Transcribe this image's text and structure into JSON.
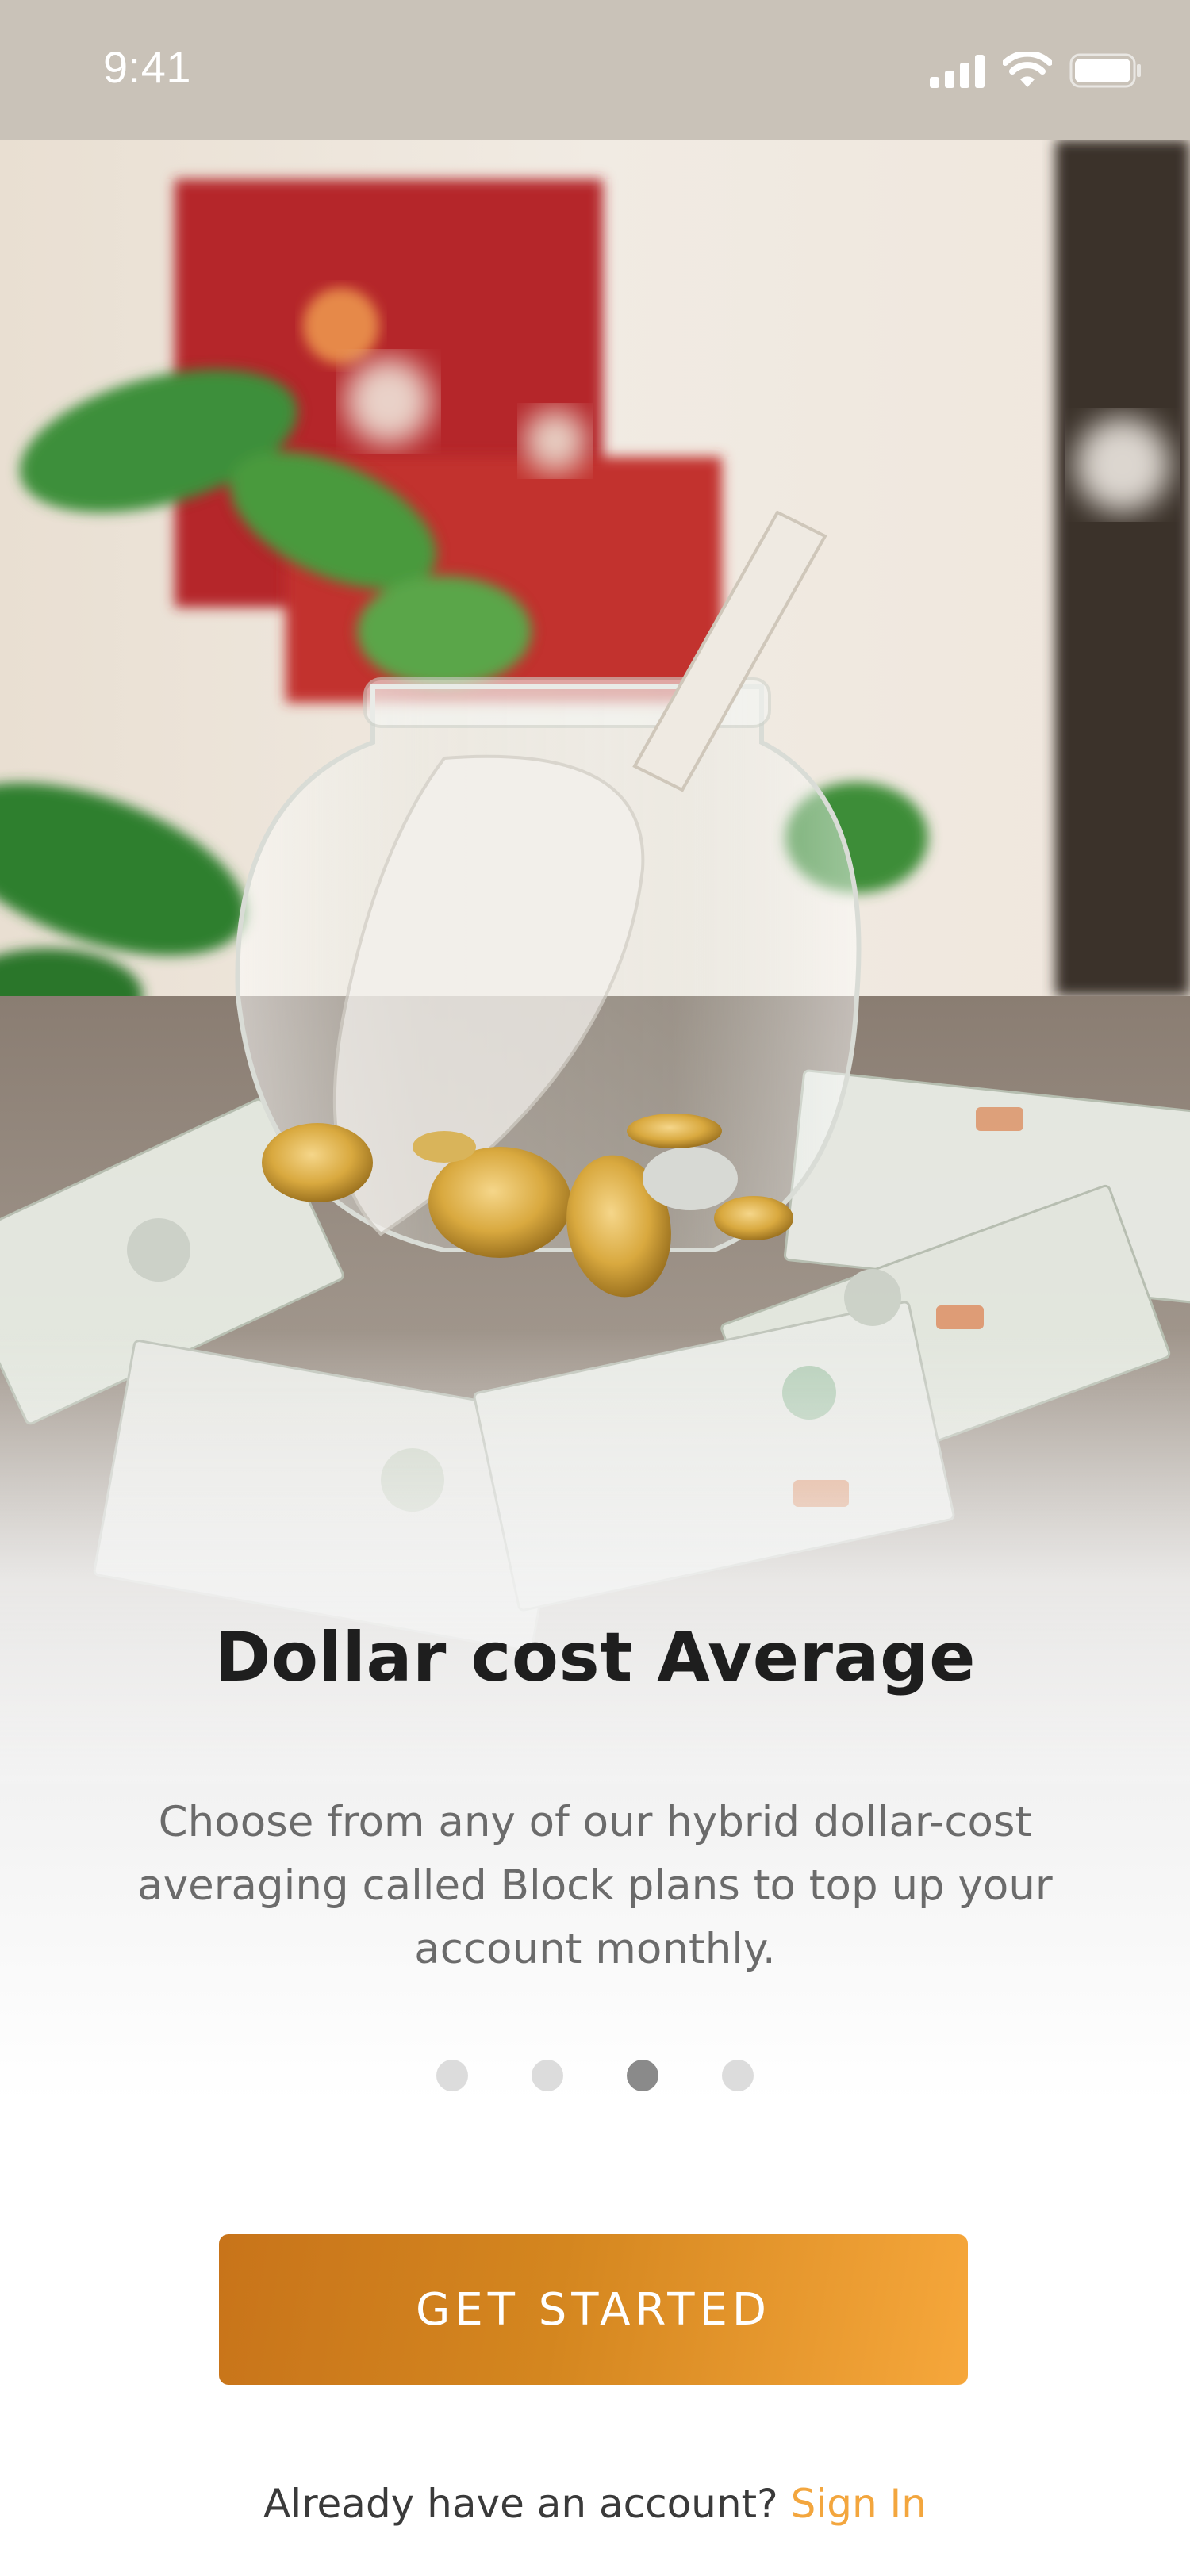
{
  "status_bar": {
    "time": "9:41"
  },
  "onboarding": {
    "title": "Dollar cost Average",
    "description": "Choose from any of our hybrid dollar-cost averaging called Block plans to top up your account monthly.",
    "pager": {
      "total": 4,
      "active_index": 2
    },
    "cta_label": "GET STARTED",
    "signin_prompt": "Already have an account?",
    "signin_link": "Sign In"
  },
  "colors": {
    "accent_start": "#c8741a",
    "accent_end": "#f6a73b",
    "link": "#f3a63e",
    "title": "#1e1e1e",
    "body_text": "#6b6b6b"
  },
  "icons": [
    "signal-icon",
    "wifi-icon",
    "battery-icon"
  ]
}
